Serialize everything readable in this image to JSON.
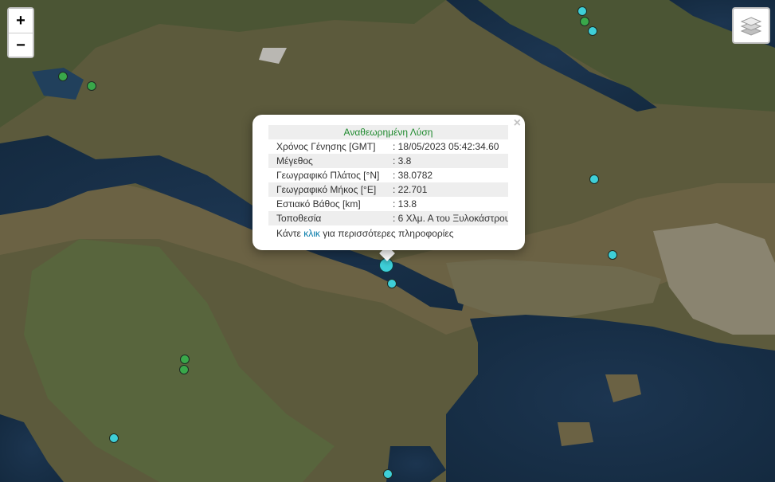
{
  "map": {
    "zoom_in_label": "+",
    "zoom_out_label": "−",
    "layers_icon": "layers-icon"
  },
  "popup": {
    "close_label": "×",
    "title": "Αναθεωρημένη Λύση",
    "rows": [
      {
        "key": "Χρόνος Γένησης [GMT]",
        "value": ": 18/05/2023 05:42:34.60"
      },
      {
        "key": "Μέγεθος",
        "value": ": 3.8"
      },
      {
        "key": "Γεωγραφικό Πλάτος [°N]",
        "value": ": 38.0782"
      },
      {
        "key": "Γεωγραφικό Μήκος [°E]",
        "value": ": 22.701"
      },
      {
        "key": "Εστιακό Βάθος [km]",
        "value": ": 13.8"
      },
      {
        "key": "Τοποθεσία",
        "value": ": 6 Χλμ. Α του Ξυλοκάστρου"
      }
    ],
    "more_prefix": "Κάντε",
    "more_link": "κλικ",
    "more_suffix": "για περισσότερες πληροφορίες",
    "title_color": "#1f8a2e",
    "link_color": "#0078a8"
  },
  "markers": {
    "cyan_color": "#3ecfd8",
    "green_color": "#39a84a"
  }
}
